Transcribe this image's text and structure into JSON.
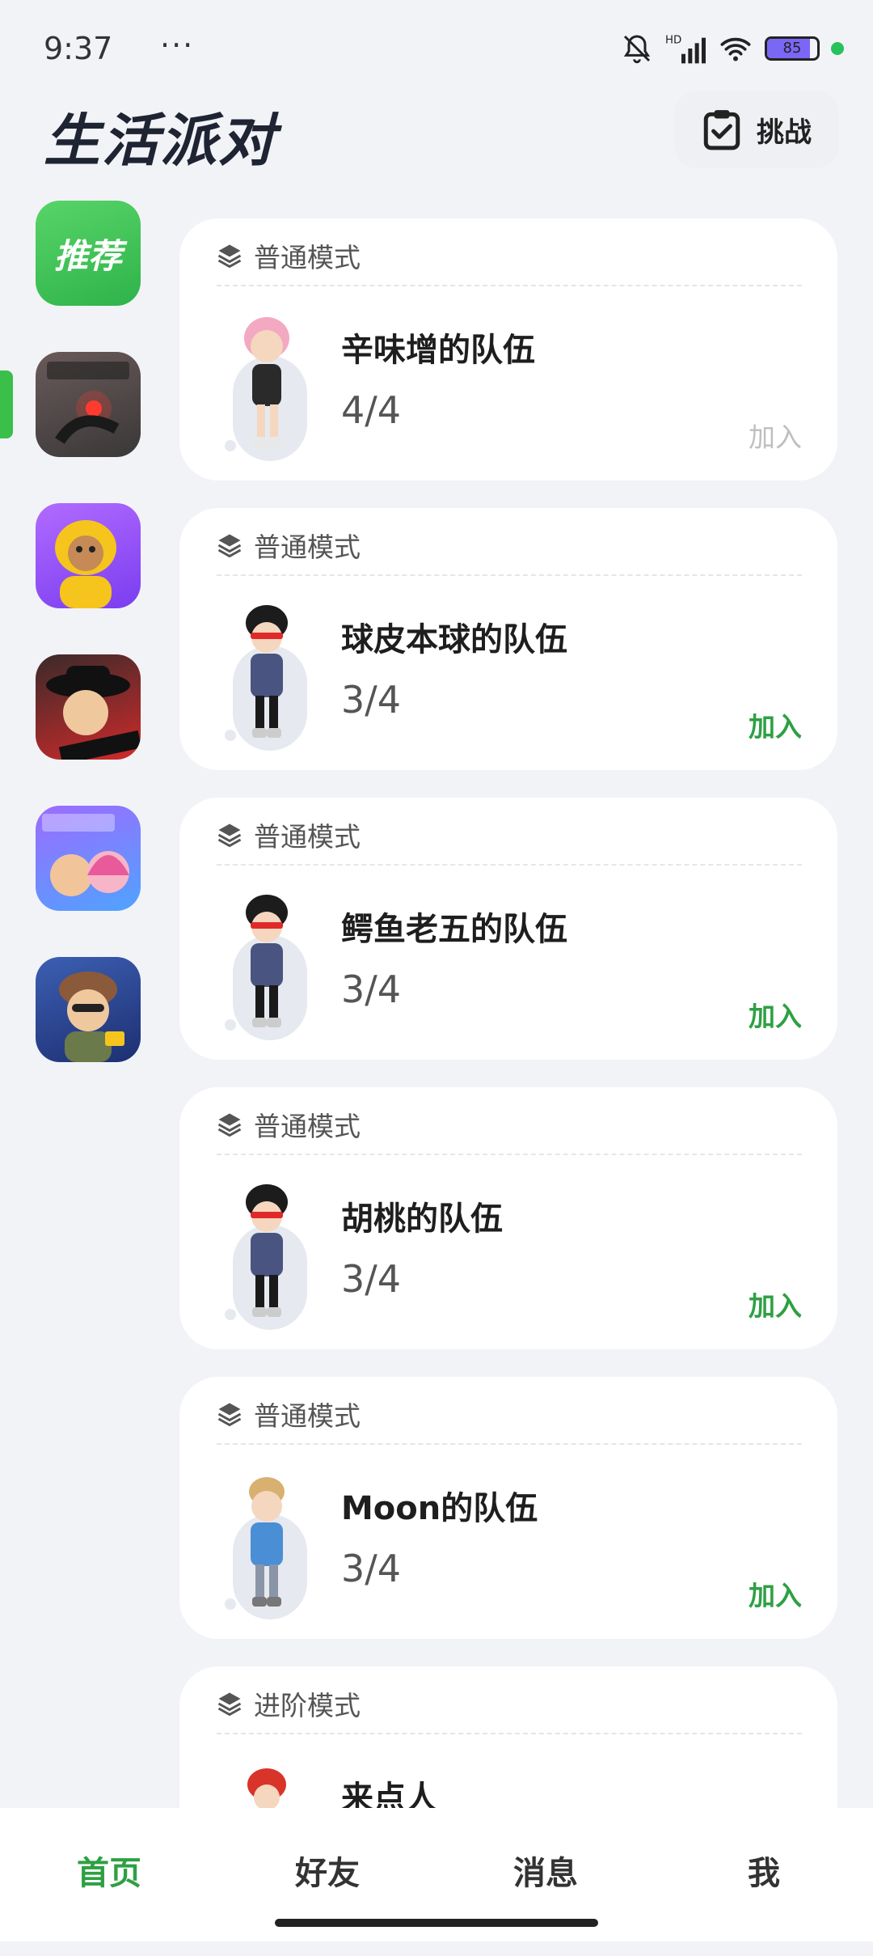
{
  "status_bar": {
    "time": "9:37",
    "dots": "···",
    "battery_level": "85"
  },
  "header": {
    "app_title": "生活派对",
    "challenge_label": "挑战"
  },
  "sidebar": {
    "items": [
      {
        "label": "推荐",
        "icon": "recommend-icon",
        "active": true
      },
      {
        "label": "",
        "icon": "game-icon-1"
      },
      {
        "label": "",
        "icon": "game-icon-2"
      },
      {
        "label": "",
        "icon": "game-icon-3"
      },
      {
        "label": "",
        "icon": "game-icon-4"
      },
      {
        "label": "",
        "icon": "game-icon-5"
      }
    ]
  },
  "teams": [
    {
      "mode": "普通模式",
      "name": "辛味增的队伍",
      "count": "4/4",
      "join": "加入",
      "full": true
    },
    {
      "mode": "普通模式",
      "name": "球皮本球的队伍",
      "count": "3/4",
      "join": "加入",
      "full": false
    },
    {
      "mode": "普通模式",
      "name": "鳄鱼老五的队伍",
      "count": "3/4",
      "join": "加入",
      "full": false
    },
    {
      "mode": "普通模式",
      "name": "胡桃的队伍",
      "count": "3/4",
      "join": "加入",
      "full": false
    },
    {
      "mode": "普通模式",
      "name": "Moon的队伍",
      "count": "3/4",
      "join": "加入",
      "full": false
    },
    {
      "mode": "进阶模式",
      "name": "来点人",
      "count": "",
      "join": "",
      "full": false
    }
  ],
  "bottom_nav": {
    "items": [
      {
        "label": "首页",
        "active": true
      },
      {
        "label": "好友",
        "active": false
      },
      {
        "label": "消息",
        "active": false
      },
      {
        "label": "我",
        "active": false
      }
    ]
  },
  "colors": {
    "accent": "#2ea043",
    "background": "#f2f3f7",
    "card": "#ffffff"
  }
}
